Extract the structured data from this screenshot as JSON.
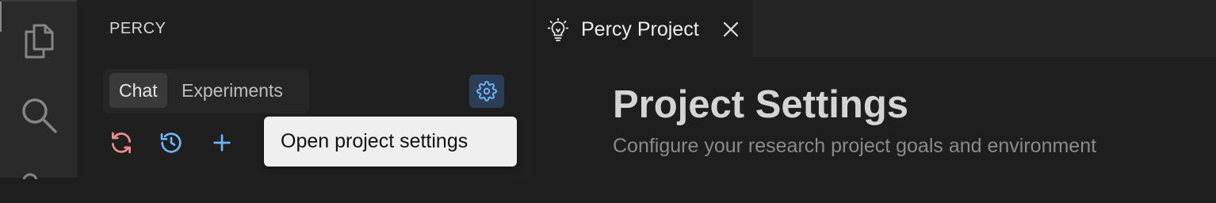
{
  "sidebar": {
    "title": "PERCY",
    "tabs": [
      {
        "label": "Chat",
        "selected": true
      },
      {
        "label": "Experiments",
        "selected": false
      }
    ]
  },
  "tooltip": {
    "text": "Open project settings"
  },
  "editor_tab": {
    "label": "Percy Project",
    "icon": "lightbulb-icon"
  },
  "page": {
    "heading": "Project Settings",
    "subtitle": "Configure your research project goals and environment"
  },
  "colors": {
    "accent_blue": "#6cb6ff",
    "refresh_pink": "#f28b8b",
    "settings_button_bg": "#2c3e55"
  },
  "icons": {
    "activity_bar": [
      "files-icon",
      "search-icon"
    ],
    "toolbar": [
      "refresh-icon",
      "history-icon",
      "add-icon"
    ],
    "settings": "gear-icon"
  }
}
